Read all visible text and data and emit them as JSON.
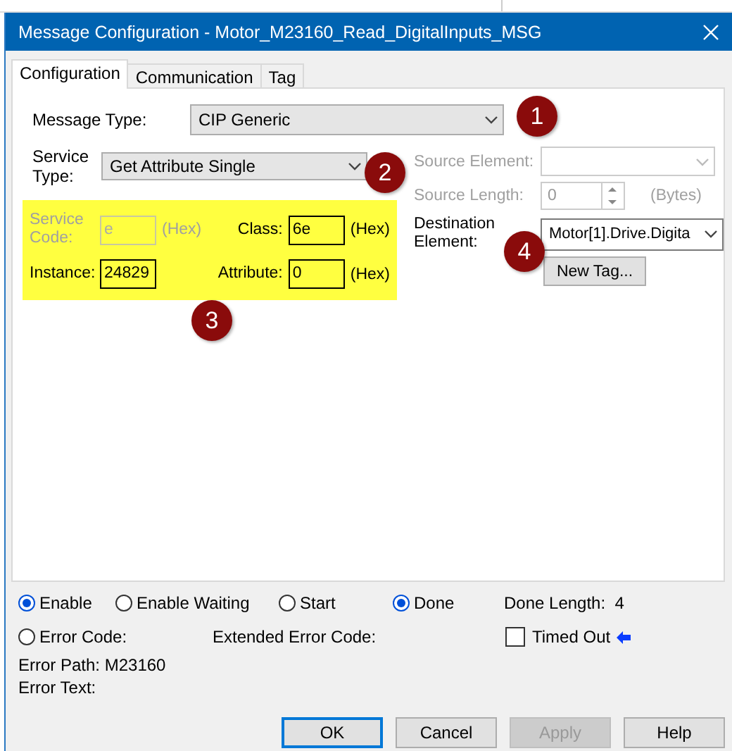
{
  "window": {
    "title": "Message Configuration - Motor_M23160_Read_DigitalInputs_MSG"
  },
  "tabs": [
    {
      "label": "Configuration",
      "selected": true
    },
    {
      "label": "Communication",
      "selected": false
    },
    {
      "label": "Tag",
      "selected": false
    }
  ],
  "message_type": {
    "label": "Message Type:",
    "value": "CIP Generic"
  },
  "service_type": {
    "label": "Service Type:",
    "value": "Get Attribute Single"
  },
  "parameters": [
    {
      "label": "Service Code:",
      "value": "e",
      "unit": "(Hex)",
      "disabled": true
    },
    {
      "label": "Class:",
      "value": "6e",
      "unit": "(Hex)",
      "disabled": false
    },
    {
      "label": "Instance:",
      "value": "24829",
      "disabled": false
    },
    {
      "label": "Attribute:",
      "value": "0",
      "unit": "(Hex)",
      "disabled": false
    }
  ],
  "source_element": {
    "label": "Source Element:",
    "disabled": true
  },
  "source_length": {
    "label": "Source Length:",
    "value": "0",
    "unit": "(Bytes)",
    "disabled": true
  },
  "destination_element": {
    "label": "Destination Element:",
    "value": "Motor[1].Drive.Digita"
  },
  "new_tag_button": {
    "label": "New Tag..."
  },
  "callouts": [
    {
      "number": "1"
    },
    {
      "number": "2"
    },
    {
      "number": "3"
    },
    {
      "number": "4"
    }
  ],
  "status": {
    "flags": [
      {
        "label": "Enable",
        "on": true
      },
      {
        "label": "Enable Waiting",
        "on": false
      },
      {
        "label": "Start",
        "on": false
      },
      {
        "label": "Done",
        "on": true
      }
    ],
    "done_length": {
      "label": "Done Length:",
      "value": "4"
    },
    "error_code": {
      "label": "Error Code:",
      "on": false
    },
    "extended_error_code": {
      "label": "Extended Error Code:"
    },
    "timed_out": {
      "label": "Timed Out",
      "checked": false
    },
    "error_path": {
      "label": "Error Path:",
      "value": "M23160"
    },
    "error_text": {
      "label": "Error Text:"
    }
  },
  "buttons": [
    {
      "label": "OK",
      "kind": "default",
      "disabled": false
    },
    {
      "label": "Cancel",
      "kind": "normal",
      "disabled": false
    },
    {
      "label": "Apply",
      "kind": "normal",
      "disabled": true
    },
    {
      "label": "Help",
      "kind": "normal",
      "disabled": false
    }
  ]
}
